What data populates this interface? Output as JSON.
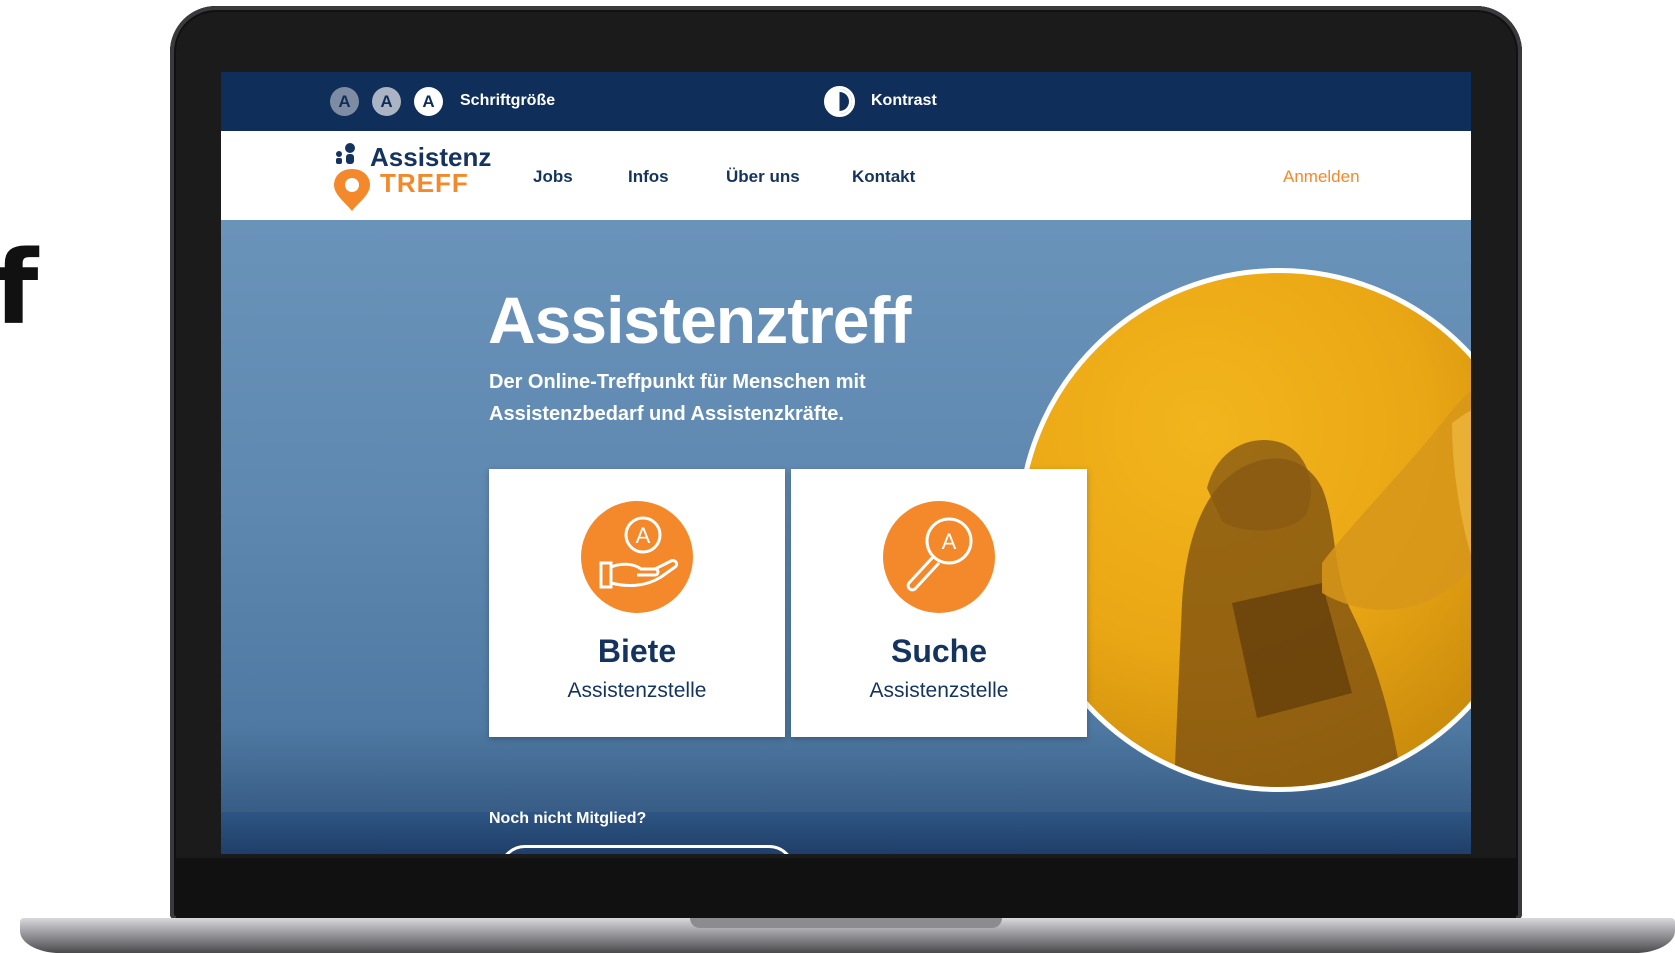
{
  "background_text": "f",
  "a11y_bar": {
    "font_small": "A",
    "font_normal": "A",
    "font_large": "A",
    "font_label": "Schriftgröße",
    "contrast_label": "Kontrast"
  },
  "nav": {
    "logo_line1": "Assistenz",
    "logo_line2": "TREFF",
    "links": [
      "Jobs",
      "Infos",
      "Über uns",
      "Kontakt"
    ],
    "login": "Anmelden"
  },
  "hero": {
    "title": "Assistenztreff",
    "subtitle": "Der Online-Treffpunkt für Menschen mit Assistenzbedarf und Assistenzkräfte.",
    "cards": [
      {
        "title": "Biete",
        "subtitle": "Assistenzstelle",
        "icon": "hand-offer-icon"
      },
      {
        "title": "Suche",
        "subtitle": "Assistenzstelle",
        "icon": "magnifier-search-icon"
      }
    ],
    "member_prompt": "Noch nicht Mitglied?"
  },
  "colors": {
    "navy": "#0f2e59",
    "orange": "#f3892b",
    "hero_blue": "#5f88b0",
    "photo_yellow": "#eaa715"
  }
}
